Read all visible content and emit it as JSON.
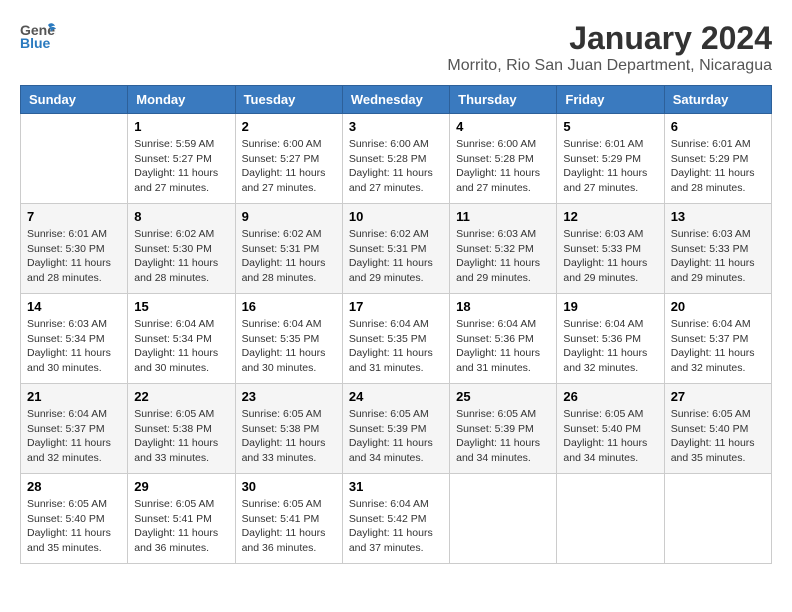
{
  "header": {
    "logo_general": "General",
    "logo_blue": "Blue",
    "month_title": "January 2024",
    "location": "Morrito, Rio San Juan Department, Nicaragua"
  },
  "calendar": {
    "days_of_week": [
      "Sunday",
      "Monday",
      "Tuesday",
      "Wednesday",
      "Thursday",
      "Friday",
      "Saturday"
    ],
    "weeks": [
      [
        {
          "day": "",
          "info": ""
        },
        {
          "day": "1",
          "info": "Sunrise: 5:59 AM\nSunset: 5:27 PM\nDaylight: 11 hours\nand 27 minutes."
        },
        {
          "day": "2",
          "info": "Sunrise: 6:00 AM\nSunset: 5:27 PM\nDaylight: 11 hours\nand 27 minutes."
        },
        {
          "day": "3",
          "info": "Sunrise: 6:00 AM\nSunset: 5:28 PM\nDaylight: 11 hours\nand 27 minutes."
        },
        {
          "day": "4",
          "info": "Sunrise: 6:00 AM\nSunset: 5:28 PM\nDaylight: 11 hours\nand 27 minutes."
        },
        {
          "day": "5",
          "info": "Sunrise: 6:01 AM\nSunset: 5:29 PM\nDaylight: 11 hours\nand 27 minutes."
        },
        {
          "day": "6",
          "info": "Sunrise: 6:01 AM\nSunset: 5:29 PM\nDaylight: 11 hours\nand 28 minutes."
        }
      ],
      [
        {
          "day": "7",
          "info": "Sunrise: 6:01 AM\nSunset: 5:30 PM\nDaylight: 11 hours\nand 28 minutes."
        },
        {
          "day": "8",
          "info": "Sunrise: 6:02 AM\nSunset: 5:30 PM\nDaylight: 11 hours\nand 28 minutes."
        },
        {
          "day": "9",
          "info": "Sunrise: 6:02 AM\nSunset: 5:31 PM\nDaylight: 11 hours\nand 28 minutes."
        },
        {
          "day": "10",
          "info": "Sunrise: 6:02 AM\nSunset: 5:31 PM\nDaylight: 11 hours\nand 29 minutes."
        },
        {
          "day": "11",
          "info": "Sunrise: 6:03 AM\nSunset: 5:32 PM\nDaylight: 11 hours\nand 29 minutes."
        },
        {
          "day": "12",
          "info": "Sunrise: 6:03 AM\nSunset: 5:33 PM\nDaylight: 11 hours\nand 29 minutes."
        },
        {
          "day": "13",
          "info": "Sunrise: 6:03 AM\nSunset: 5:33 PM\nDaylight: 11 hours\nand 29 minutes."
        }
      ],
      [
        {
          "day": "14",
          "info": "Sunrise: 6:03 AM\nSunset: 5:34 PM\nDaylight: 11 hours\nand 30 minutes."
        },
        {
          "day": "15",
          "info": "Sunrise: 6:04 AM\nSunset: 5:34 PM\nDaylight: 11 hours\nand 30 minutes."
        },
        {
          "day": "16",
          "info": "Sunrise: 6:04 AM\nSunset: 5:35 PM\nDaylight: 11 hours\nand 30 minutes."
        },
        {
          "day": "17",
          "info": "Sunrise: 6:04 AM\nSunset: 5:35 PM\nDaylight: 11 hours\nand 31 minutes."
        },
        {
          "day": "18",
          "info": "Sunrise: 6:04 AM\nSunset: 5:36 PM\nDaylight: 11 hours\nand 31 minutes."
        },
        {
          "day": "19",
          "info": "Sunrise: 6:04 AM\nSunset: 5:36 PM\nDaylight: 11 hours\nand 32 minutes."
        },
        {
          "day": "20",
          "info": "Sunrise: 6:04 AM\nSunset: 5:37 PM\nDaylight: 11 hours\nand 32 minutes."
        }
      ],
      [
        {
          "day": "21",
          "info": "Sunrise: 6:04 AM\nSunset: 5:37 PM\nDaylight: 11 hours\nand 32 minutes."
        },
        {
          "day": "22",
          "info": "Sunrise: 6:05 AM\nSunset: 5:38 PM\nDaylight: 11 hours\nand 33 minutes."
        },
        {
          "day": "23",
          "info": "Sunrise: 6:05 AM\nSunset: 5:38 PM\nDaylight: 11 hours\nand 33 minutes."
        },
        {
          "day": "24",
          "info": "Sunrise: 6:05 AM\nSunset: 5:39 PM\nDaylight: 11 hours\nand 34 minutes."
        },
        {
          "day": "25",
          "info": "Sunrise: 6:05 AM\nSunset: 5:39 PM\nDaylight: 11 hours\nand 34 minutes."
        },
        {
          "day": "26",
          "info": "Sunrise: 6:05 AM\nSunset: 5:40 PM\nDaylight: 11 hours\nand 34 minutes."
        },
        {
          "day": "27",
          "info": "Sunrise: 6:05 AM\nSunset: 5:40 PM\nDaylight: 11 hours\nand 35 minutes."
        }
      ],
      [
        {
          "day": "28",
          "info": "Sunrise: 6:05 AM\nSunset: 5:40 PM\nDaylight: 11 hours\nand 35 minutes."
        },
        {
          "day": "29",
          "info": "Sunrise: 6:05 AM\nSunset: 5:41 PM\nDaylight: 11 hours\nand 36 minutes."
        },
        {
          "day": "30",
          "info": "Sunrise: 6:05 AM\nSunset: 5:41 PM\nDaylight: 11 hours\nand 36 minutes."
        },
        {
          "day": "31",
          "info": "Sunrise: 6:04 AM\nSunset: 5:42 PM\nDaylight: 11 hours\nand 37 minutes."
        },
        {
          "day": "",
          "info": ""
        },
        {
          "day": "",
          "info": ""
        },
        {
          "day": "",
          "info": ""
        }
      ]
    ]
  }
}
